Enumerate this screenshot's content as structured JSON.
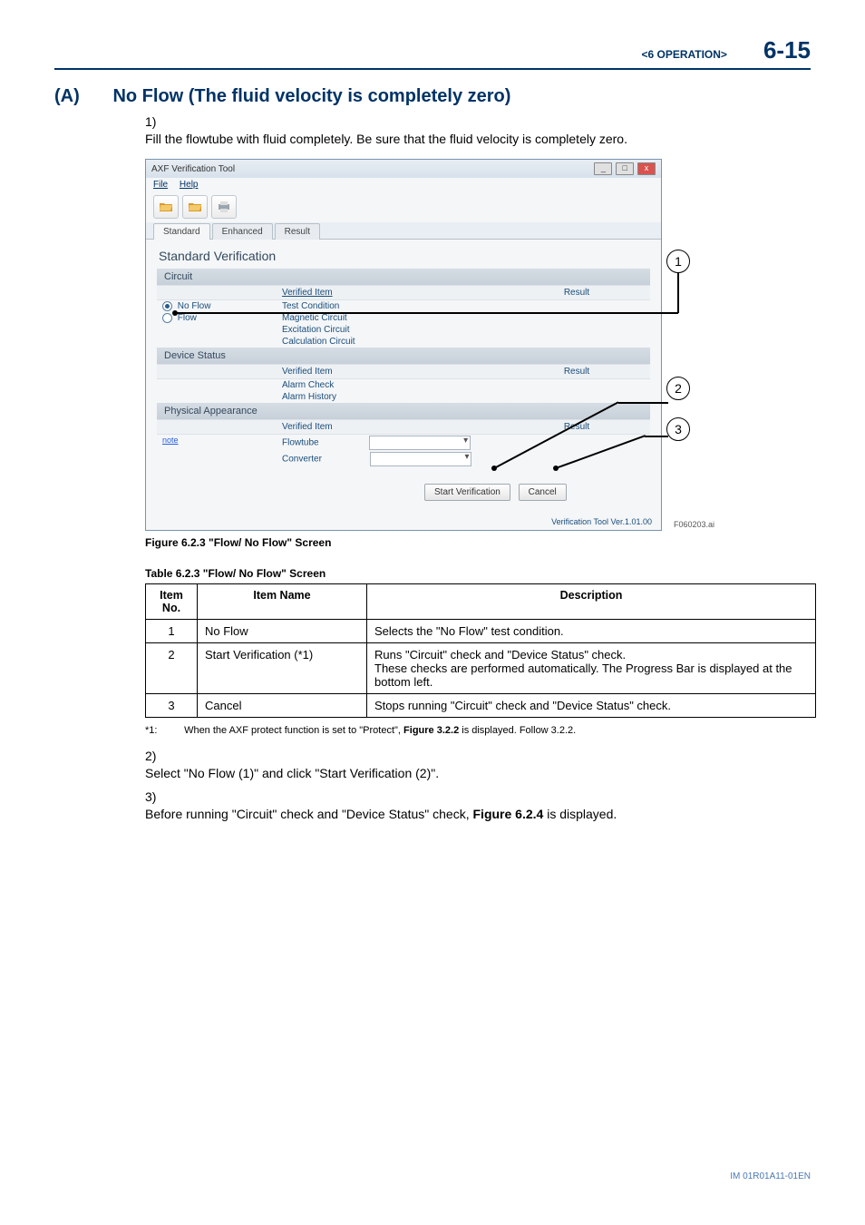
{
  "header": {
    "chapter": "<6  OPERATION>",
    "pageno": "6-15"
  },
  "section": {
    "letter": "(A)",
    "title": "No Flow (The fluid velocity is completely zero)"
  },
  "step1": {
    "num": "1)",
    "text": "Fill the flowtube with fluid completely. Be sure that the fluid velocity is completely zero."
  },
  "shot": {
    "title": "AXF Verification Tool",
    "menu_file": "File",
    "menu_help": "Help",
    "tabs": {
      "standard": "Standard",
      "enhanced": "Enhanced",
      "result": "Result"
    },
    "pane_title": "Standard Verification",
    "sec_circuit": "Circuit",
    "col_verified": "Verified Item",
    "col_result": "Result",
    "radio_noflow": "No Flow",
    "radio_flow": "Flow",
    "row_testcond": "Test Condition",
    "row_magcircuit": "Magnetic Circuit",
    "row_exccircuit": "Excitation Circuit",
    "row_calccircuit": "Calculation Circuit",
    "sec_device": "Device Status",
    "row_alarmcheck": "Alarm Check",
    "row_alarmhist": "Alarm History",
    "sec_phys": "Physical Appearance",
    "note": "note",
    "row_flowtube": "Flowtube",
    "row_converter": "Converter",
    "btn_start": "Start Verification",
    "btn_cancel": "Cancel",
    "footer_ver": "Verification Tool Ver.1.01.00",
    "fname": "F060203.ai"
  },
  "callouts": {
    "c1": "1",
    "c2": "2",
    "c3": "3"
  },
  "fig_caption": "Figure 6.2.3 \"Flow/ No Flow\" Screen",
  "tbl_caption": "Table 6.2.3 \"Flow/ No Flow\" Screen",
  "table": {
    "h_no": "Item No.",
    "h_name": "Item Name",
    "h_desc": "Description",
    "r1": {
      "no": "1",
      "name": "No Flow",
      "desc": "Selects the \"No Flow\" test condition."
    },
    "r2": {
      "no": "2",
      "name": "Start Verification (*1)",
      "desc": "Runs \"Circuit\" check and \"Device Status\" check.\nThese checks are performed automatically. The Progress Bar is displayed at the bottom left."
    },
    "r3": {
      "no": "3",
      "name": "Cancel",
      "desc": "Stops running \"Circuit\" check and \"Device Status\" check."
    }
  },
  "footnote": {
    "star": "*1:",
    "text_a": "When the AXF protect function is set to \"Protect\", ",
    "bold": "Figure 3.2.2",
    "text_b": " is displayed. Follow 3.2.2."
  },
  "step2": {
    "num": "2)",
    "text": "Select \"No Flow (1)\" and click \"Start Verification (2)\"."
  },
  "step3": {
    "num": "3)",
    "text_a": "Before running \"Circuit\" check and \"Device Status\" check, ",
    "bold": "Figure 6.2.4",
    "text_b": " is displayed."
  },
  "doc_footer": "IM 01R01A11-01EN"
}
